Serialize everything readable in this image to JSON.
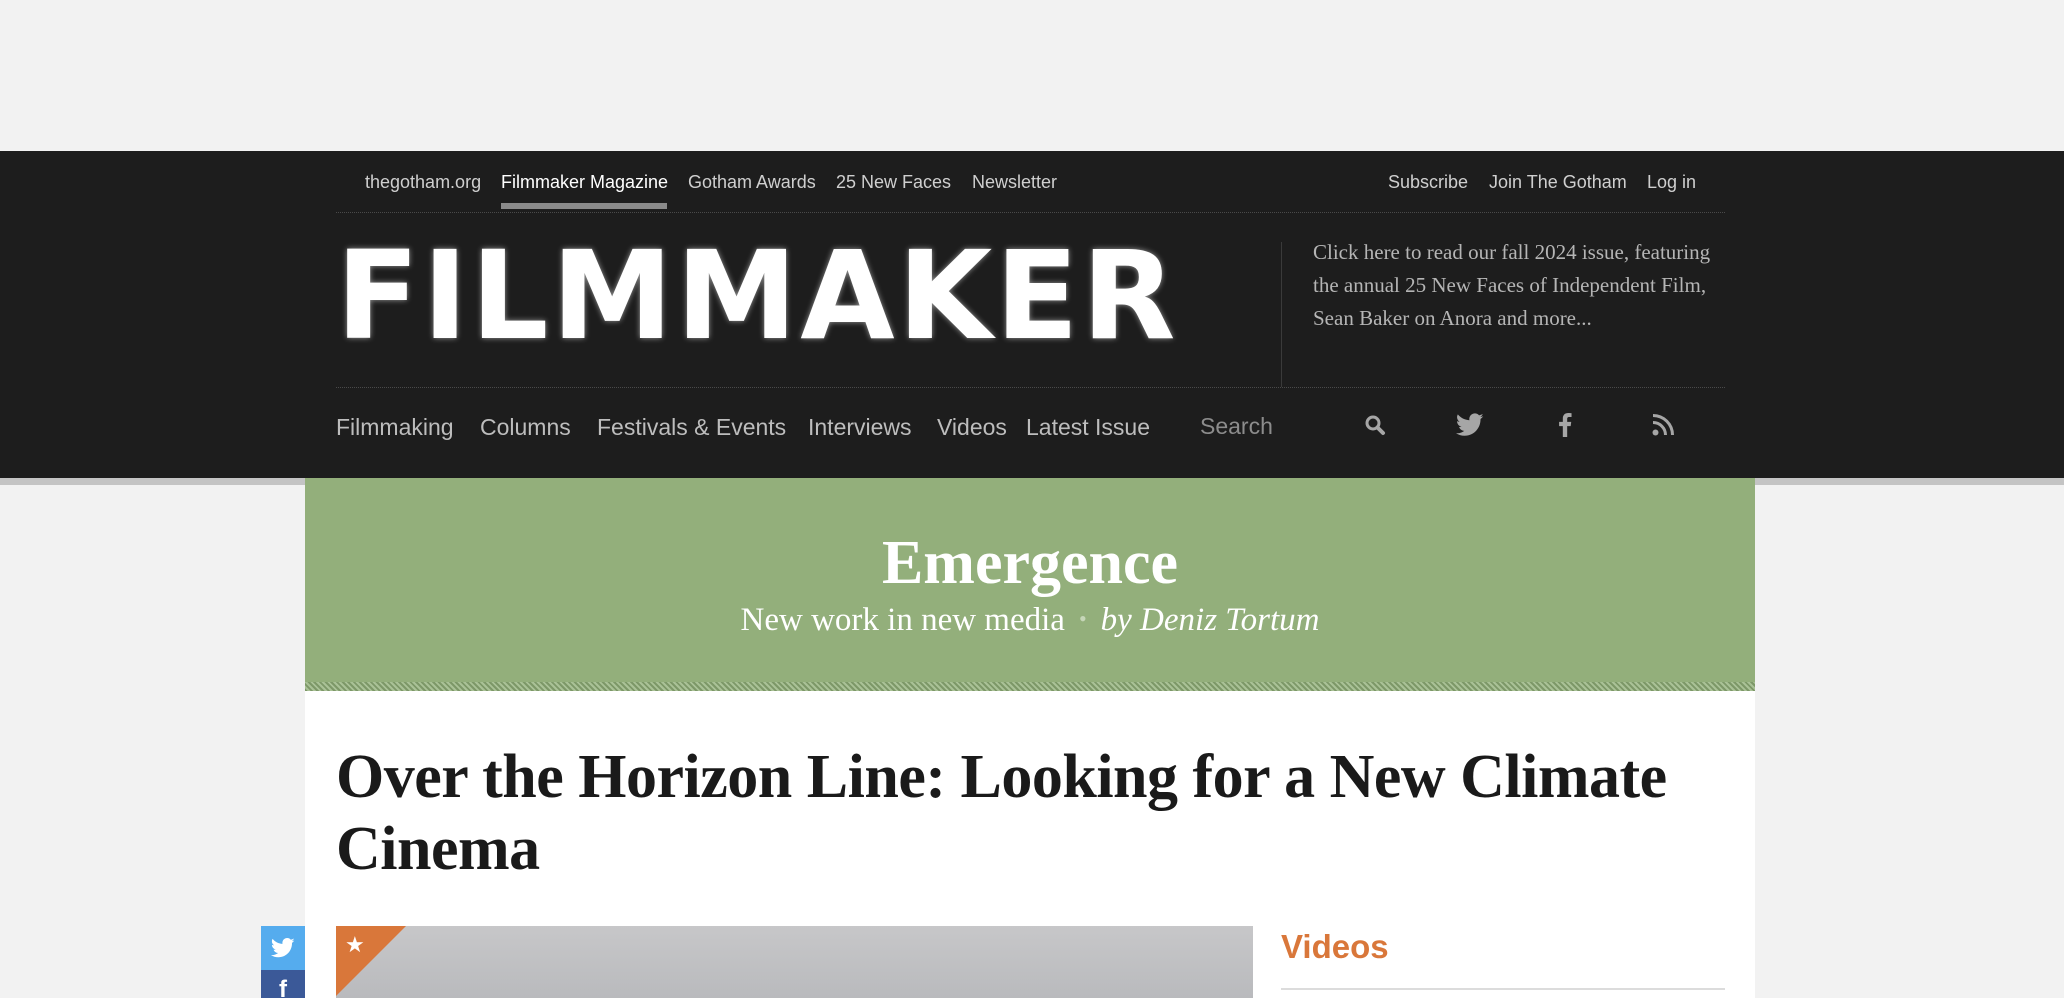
{
  "top_nav": {
    "left_links": [
      "thegotham.org",
      "Filmmaker Magazine",
      "Gotham Awards",
      "25 New Faces",
      "Newsletter"
    ],
    "right_links": [
      "Subscribe",
      "Join The Gotham",
      "Log in"
    ],
    "active": "Filmmaker Magazine"
  },
  "logo": {
    "text": "FILMMAKER"
  },
  "promo": {
    "text": "Click here to read our fall 2024 issue, featuring the annual 25 New Faces of Independent Film, Sean Baker on Anora and more..."
  },
  "main_nav": {
    "items": [
      "Filmmaking",
      "Columns",
      "Festivals & Events",
      "Interviews",
      "Videos",
      "Latest Issue"
    ],
    "search_placeholder": "Search",
    "icons": [
      "search-icon",
      "twitter-icon",
      "facebook-icon",
      "rss-icon"
    ]
  },
  "banner": {
    "title": "Emergence",
    "subtitle": "New work in new media",
    "separator": "•",
    "byline": "by Deniz Tortum"
  },
  "article": {
    "title": "Over the Horizon Line: Looking for a New Climate Cinema",
    "featured_badge": "★"
  },
  "sidebar": {
    "heading": "Videos"
  },
  "share": {
    "facebook_glyph": "f"
  },
  "colors": {
    "header_bg": "#1d1d1d",
    "banner_green": "#93af7b",
    "accent_orange": "#d9773a",
    "twitter_blue": "#55acee",
    "facebook_blue": "#3b5998"
  }
}
